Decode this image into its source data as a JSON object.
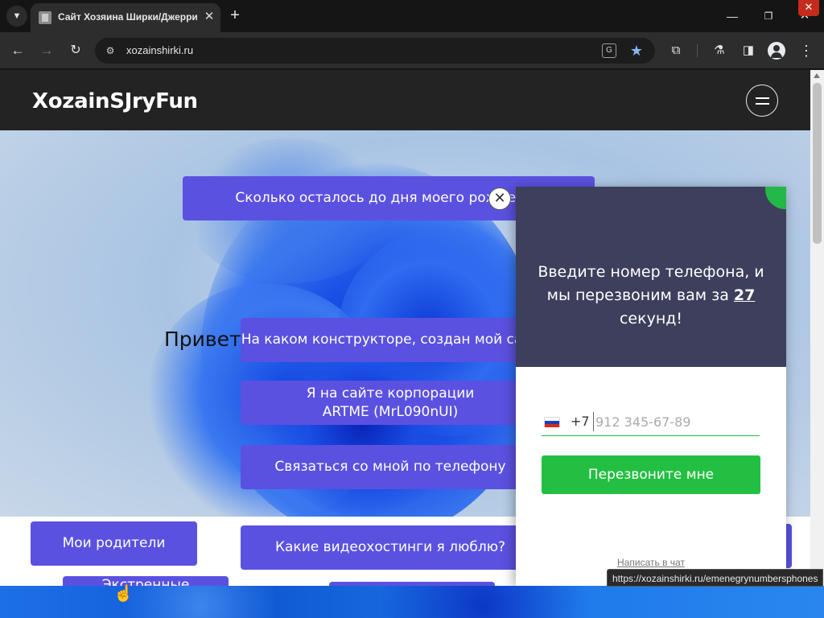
{
  "browser": {
    "tab_title": "Сайт Хозяина Ширки/Джерри",
    "url": "xozainshirki.ru",
    "status_url": "https://xozainshirki.ru/emenegrynumbersphones"
  },
  "site": {
    "logo": "XozainSJryFun",
    "hero_heading": "Привет! Ты зашел на сайт Хозяина",
    "buttons": {
      "birthday": "Сколько осталось до дня моего рождения",
      "constructor": "На каком конструкторе, создан мой сайт",
      "artme": "Я на сайте корпорации ARTME (MrL090nUI)",
      "phone": "Связаться со мной по телефону",
      "parents": "Мои родители",
      "video": "Какие видеохостинги я люблю?",
      "emergency": "Экстренные"
    }
  },
  "widget": {
    "headline_part1": "Введите номер телефона, и мы перезвоним вам за",
    "seconds": "27",
    "headline_part2": "секунд!",
    "country_code": "+7",
    "phone_placeholder": "912 345-67-89",
    "button": "Перезвоните мне",
    "chat_link": "Написать в чат"
  },
  "colors": {
    "accent": "#5b51e0",
    "callback_green": "#23bf42",
    "widget_top": "#3d3f5c"
  }
}
